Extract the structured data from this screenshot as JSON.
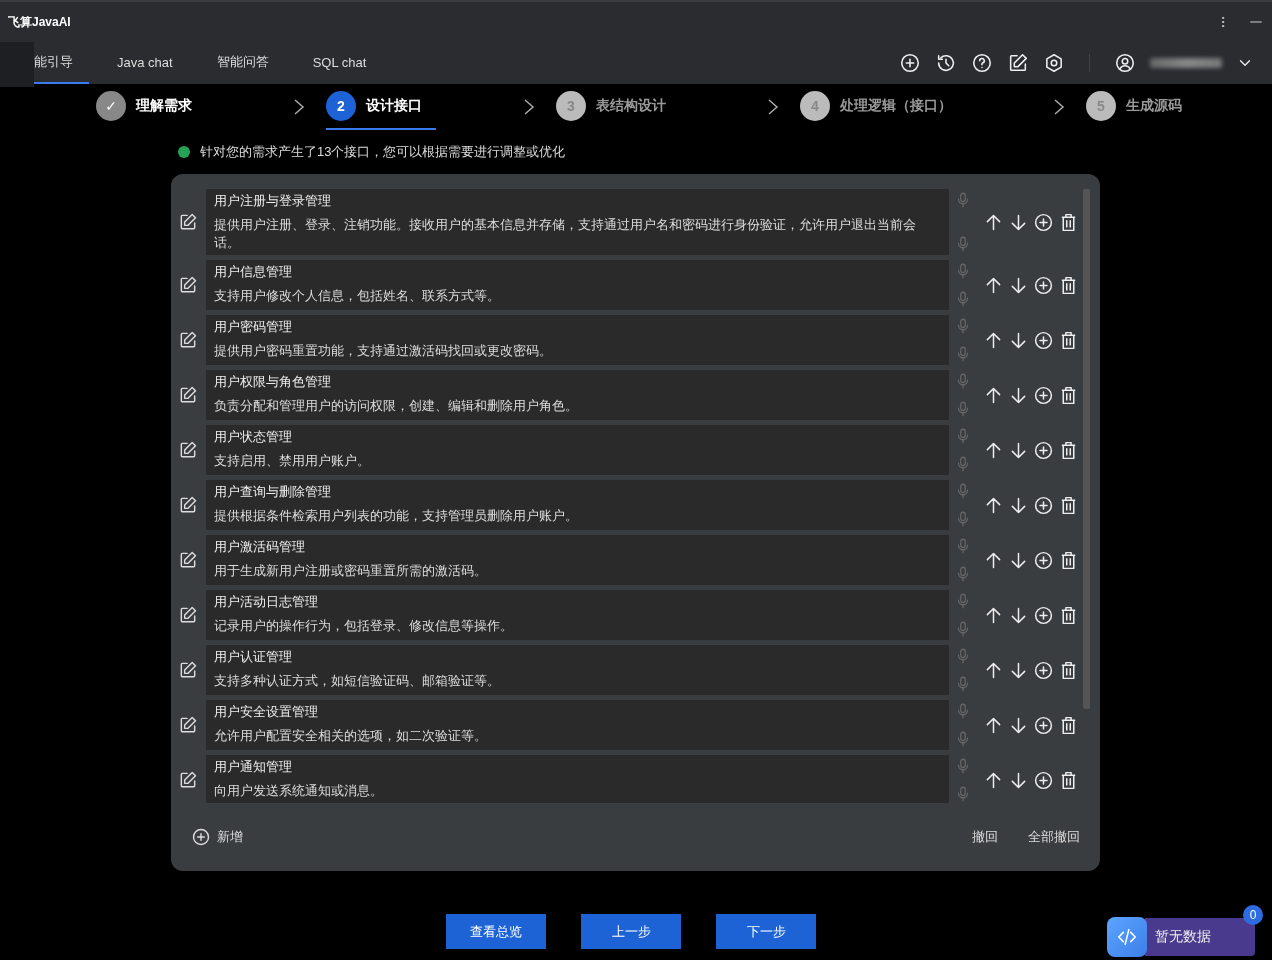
{
  "window": {
    "title": "飞算JavaAI"
  },
  "tabs": [
    {
      "label": "能引导",
      "selected": true
    },
    {
      "label": "Java chat",
      "selected": false
    },
    {
      "label": "智能问答",
      "selected": false
    },
    {
      "label": "SQL chat",
      "selected": false
    }
  ],
  "steps": [
    {
      "number": "✓",
      "label": "理解需求",
      "completed": true,
      "selected": false
    },
    {
      "number": "2",
      "label": "设计接口",
      "completed": false,
      "selected": true
    },
    {
      "number": "3",
      "label": "表结构设计",
      "completed": false,
      "selected": false
    },
    {
      "number": "4",
      "label": "处理逻辑（接口）",
      "completed": false,
      "selected": false
    },
    {
      "number": "5",
      "label": "生成源码",
      "completed": false,
      "selected": false
    }
  ],
  "notice": "针对您的需求产生了13个接口，您可以根据需要进行调整或优化",
  "interfaces": [
    {
      "name": "用户注册与登录管理",
      "description": "提供用户注册、登录、注销功能。接收用户的基本信息并存储，支持通过用户名和密码进行身份验证，允许用户退出当前会话。"
    },
    {
      "name": "用户信息管理",
      "description": "支持用户修改个人信息，包括姓名、联系方式等。"
    },
    {
      "name": "用户密码管理",
      "description": "提供用户密码重置功能，支持通过激活码找回或更改密码。"
    },
    {
      "name": "用户权限与角色管理",
      "description": "负责分配和管理用户的访问权限，创建、编辑和删除用户角色。"
    },
    {
      "name": "用户状态管理",
      "description": "支持启用、禁用用户账户。"
    },
    {
      "name": "用户查询与删除管理",
      "description": "提供根据条件检索用户列表的功能，支持管理员删除用户账户。"
    },
    {
      "name": "用户激活码管理",
      "description": "用于生成新用户注册或密码重置所需的激活码。"
    },
    {
      "name": "用户活动日志管理",
      "description": "记录用户的操作行为，包括登录、修改信息等操作。"
    },
    {
      "name": "用户认证管理",
      "description": "支持多种认证方式，如短信验证码、邮箱验证等。"
    },
    {
      "name": "用户安全设置管理",
      "description": "允许用户配置安全相关的选项，如二次验证等。"
    },
    {
      "name": "用户通知管理",
      "description": "向用户发送系统通知或消息。"
    }
  ],
  "footer": {
    "add": "新增",
    "undo": "撤回",
    "undo_all": "全部撤回"
  },
  "buttons": [
    "查看总览",
    "上一步",
    "下一步"
  ],
  "widget": {
    "label": "暂无数据",
    "count": "0"
  }
}
